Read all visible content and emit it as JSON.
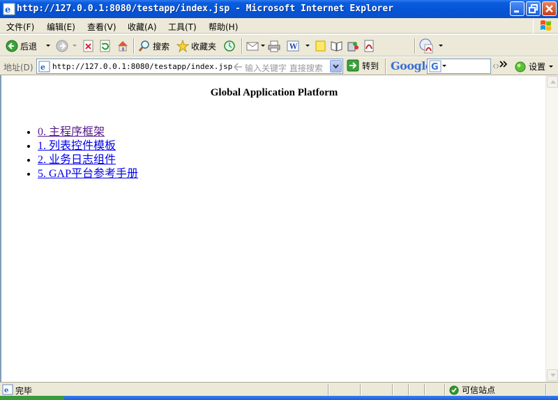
{
  "window": {
    "title": "http://127.0.0.1:8080/testapp/index.jsp - Microsoft Internet Explorer"
  },
  "menu": [
    {
      "label": "文件(F)"
    },
    {
      "label": "编辑(E)"
    },
    {
      "label": "查看(V)"
    },
    {
      "label": "收藏(A)"
    },
    {
      "label": "工具(T)"
    },
    {
      "label": "帮助(H)"
    }
  ],
  "toolbar": {
    "back_label": "后退",
    "search_label": "搜索",
    "favorites_label": "收藏夹"
  },
  "address": {
    "label": "地址(D)",
    "url": "http://127.0.0.1:8080/testapp/index.jsp",
    "hint": "输入关键字 直接搜索",
    "go_label": "转到",
    "google_label": "Google",
    "settings_label": "设置"
  },
  "page": {
    "title": "Global Application Platform",
    "links": [
      {
        "label": "0. 主程序框架",
        "visited": true
      },
      {
        "label": "1. 列表控件模板",
        "visited": false
      },
      {
        "label": "2. 业务日志组件",
        "visited": false
      },
      {
        "label": "5. GAP平台参考手册",
        "visited": false
      }
    ]
  },
  "status": {
    "text": "完毕",
    "zone": "可信站点"
  },
  "colors": {
    "titlebar": "#0553d5",
    "link": "#0000ee",
    "visited_link": "#551a8b"
  }
}
